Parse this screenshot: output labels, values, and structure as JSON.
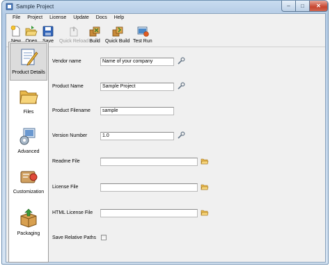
{
  "window": {
    "title": "Sample Project",
    "close_glyph": "✕",
    "minimize_glyph": "–",
    "maximize_glyph": "□"
  },
  "menu": [
    "File",
    "Project",
    "License",
    "Update",
    "Docs",
    "Help"
  ],
  "toolbar": [
    {
      "label": "New",
      "icon": "new-document-icon"
    },
    {
      "label": "Open",
      "icon": "open-folder-icon"
    },
    {
      "label": "Save",
      "icon": "save-disk-icon"
    },
    {
      "label": "Quick Reload",
      "icon": "reload-icon",
      "disabled": true
    },
    {
      "label": "Build",
      "icon": "build-icon"
    },
    {
      "label": "Quick Build",
      "icon": "quick-build-icon"
    },
    {
      "label": "Test Run",
      "icon": "test-run-icon"
    }
  ],
  "sidebar": [
    {
      "label": "Product Details",
      "icon": "product-details-icon",
      "active": true
    },
    {
      "label": "Files",
      "icon": "files-icon"
    },
    {
      "label": "Advanced",
      "icon": "advanced-icon"
    },
    {
      "label": "Customization",
      "icon": "customization-icon"
    },
    {
      "label": "Packaging",
      "icon": "packaging-icon"
    }
  ],
  "form": {
    "vendor_name": {
      "label": "Vendor name",
      "value": "Name of your company"
    },
    "product_name": {
      "label": "Product Name",
      "value": "Sample Project"
    },
    "product_filename": {
      "label": "Product Filename",
      "value": "sample"
    },
    "version_number": {
      "label": "Version Number",
      "value": "1.0"
    },
    "readme_file": {
      "label": "Readme File",
      "value": ""
    },
    "license_file": {
      "label": "License File",
      "value": ""
    },
    "html_license_file": {
      "label": "HTML License File",
      "value": ""
    },
    "save_relative_paths": {
      "label": "Save Relative Paths",
      "checked": false
    }
  },
  "colors": {
    "title_bar": "#b4cbe5",
    "close_button": "#c7452f",
    "sidebar_selected": "#dcdcdc"
  }
}
